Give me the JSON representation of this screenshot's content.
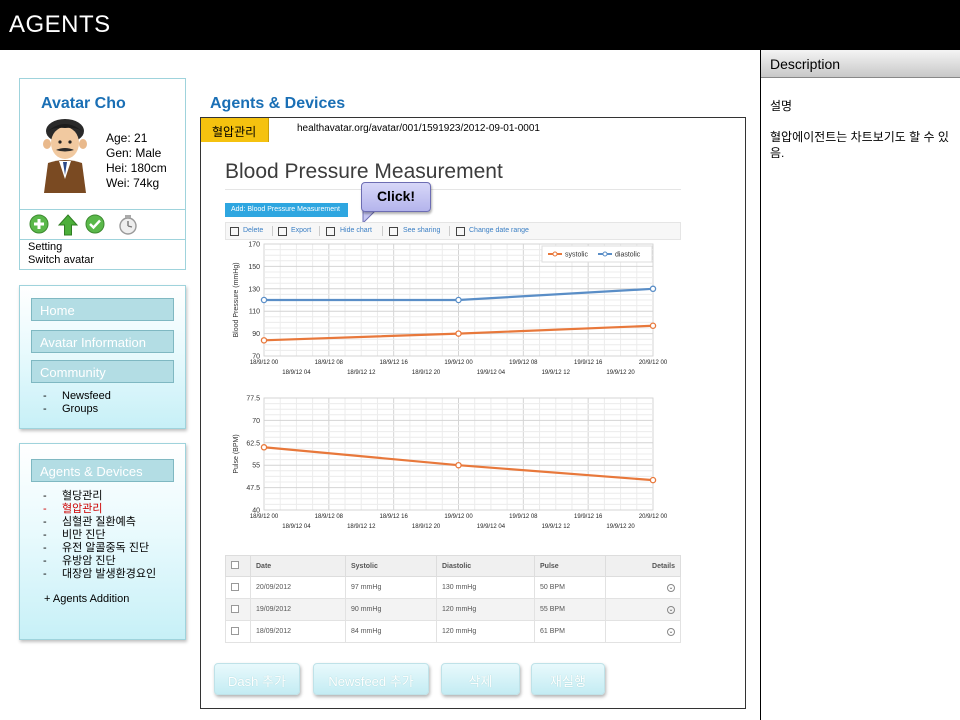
{
  "app": {
    "title": "AGENTS"
  },
  "description": {
    "header": "Description",
    "lines": [
      "설명",
      "혈압에이전트는 차트보기도 할 수 있음."
    ]
  },
  "profile": {
    "name": "Avatar Cho",
    "stats": [
      "Age: 21",
      "Gen: Male",
      "Hei: 180cm",
      "Wei: 74kg"
    ],
    "action_icons": [
      "add-icon",
      "upload-arrow-icon",
      "check-icon",
      "clock-icon"
    ],
    "links": [
      "Setting",
      "Switch avatar"
    ]
  },
  "nav": {
    "home": "Home",
    "avatar_information": "Avatar Information",
    "community": "Community",
    "community_items": [
      "Newsfeed",
      "Groups"
    ]
  },
  "agents_nav": {
    "title": "Agents & Devices",
    "items": [
      "혈당관리",
      "혈압관리",
      "심혈관 질환예측",
      "비만 진단",
      "유전 알콜중독 진단",
      "유방암 진단",
      "대장암 발생환경요인"
    ],
    "active_index": 1,
    "active_color": "#cc0000",
    "addition": "+ Agents Addition"
  },
  "main": {
    "section_title": "Agents & Devices",
    "tab_label": "혈압관리",
    "url": "healthavatar.org/avatar/001/1591923/2012-09-01-0001",
    "page_title": "Blood Pressure Measurement",
    "add_button": "Add: Blood Pressure Measurement",
    "callout": "Click!",
    "toolbar": [
      "Delete",
      "Export",
      "Hide chart",
      "See sharing",
      "Change date range"
    ]
  },
  "chart_data": [
    {
      "type": "line",
      "ylabel": "Blood Pressure (mmHg)",
      "ylim": [
        70,
        170
      ],
      "yticks": [
        70,
        90,
        110,
        130,
        150,
        170
      ],
      "x_labels_top": [
        "18/9/12 00",
        "18/9/12 08",
        "18/9/12 16",
        "19/9/12 00",
        "19/9/12 08",
        "19/9/12 16",
        "20/9/12 00"
      ],
      "x_labels_bottom": [
        "18/9/12 04",
        "18/9/12 12",
        "18/9/12 20",
        "19/9/12 04",
        "19/9/12 12",
        "19/9/12 20"
      ],
      "x": [
        "18/9/12 00",
        "19/9/12 00",
        "20/9/12 00"
      ],
      "series": [
        {
          "name": "systolic",
          "color": "#e8783b",
          "values": [
            84,
            90,
            97
          ]
        },
        {
          "name": "diastolic",
          "color": "#5a8ec7",
          "values": [
            120,
            120,
            130
          ]
        }
      ],
      "legend": "top-right",
      "grid": true
    },
    {
      "type": "line",
      "ylabel": "Pulse (BPM)",
      "ylim": [
        40,
        77.5
      ],
      "yticks": [
        40,
        47.5,
        55,
        62.5,
        70,
        77.5
      ],
      "x_labels_top": [
        "18/9/12 00",
        "18/9/12 08",
        "18/9/12 16",
        "19/9/12 00",
        "19/9/12 08",
        "19/9/12 16",
        "20/9/12 00"
      ],
      "x_labels_bottom": [
        "18/9/12 04",
        "18/9/12 12",
        "18/9/12 20",
        "19/9/12 04",
        "19/9/12 12",
        "19/9/12 20"
      ],
      "x": [
        "18/9/12 00",
        "19/9/12 00",
        "20/9/12 00"
      ],
      "series": [
        {
          "color": "#e8783b",
          "values": [
            61,
            55,
            50
          ]
        }
      ],
      "grid": true
    }
  ],
  "table": {
    "headers": [
      "Date",
      "Systolic",
      "Diastolic",
      "Pulse",
      "Details"
    ],
    "rows": [
      {
        "date": "20/09/2012",
        "systolic": "97 mmHg",
        "diastolic": "130 mmHg",
        "pulse": "50 BPM"
      },
      {
        "date": "19/09/2012",
        "systolic": "90 mmHg",
        "diastolic": "120 mmHg",
        "pulse": "55 BPM"
      },
      {
        "date": "18/09/2012",
        "systolic": "84 mmHg",
        "diastolic": "120 mmHg",
        "pulse": "61 BPM"
      }
    ]
  },
  "bottom_buttons": [
    "Dash 추가",
    "Newsfeed 추가",
    "삭제",
    "재실행"
  ]
}
